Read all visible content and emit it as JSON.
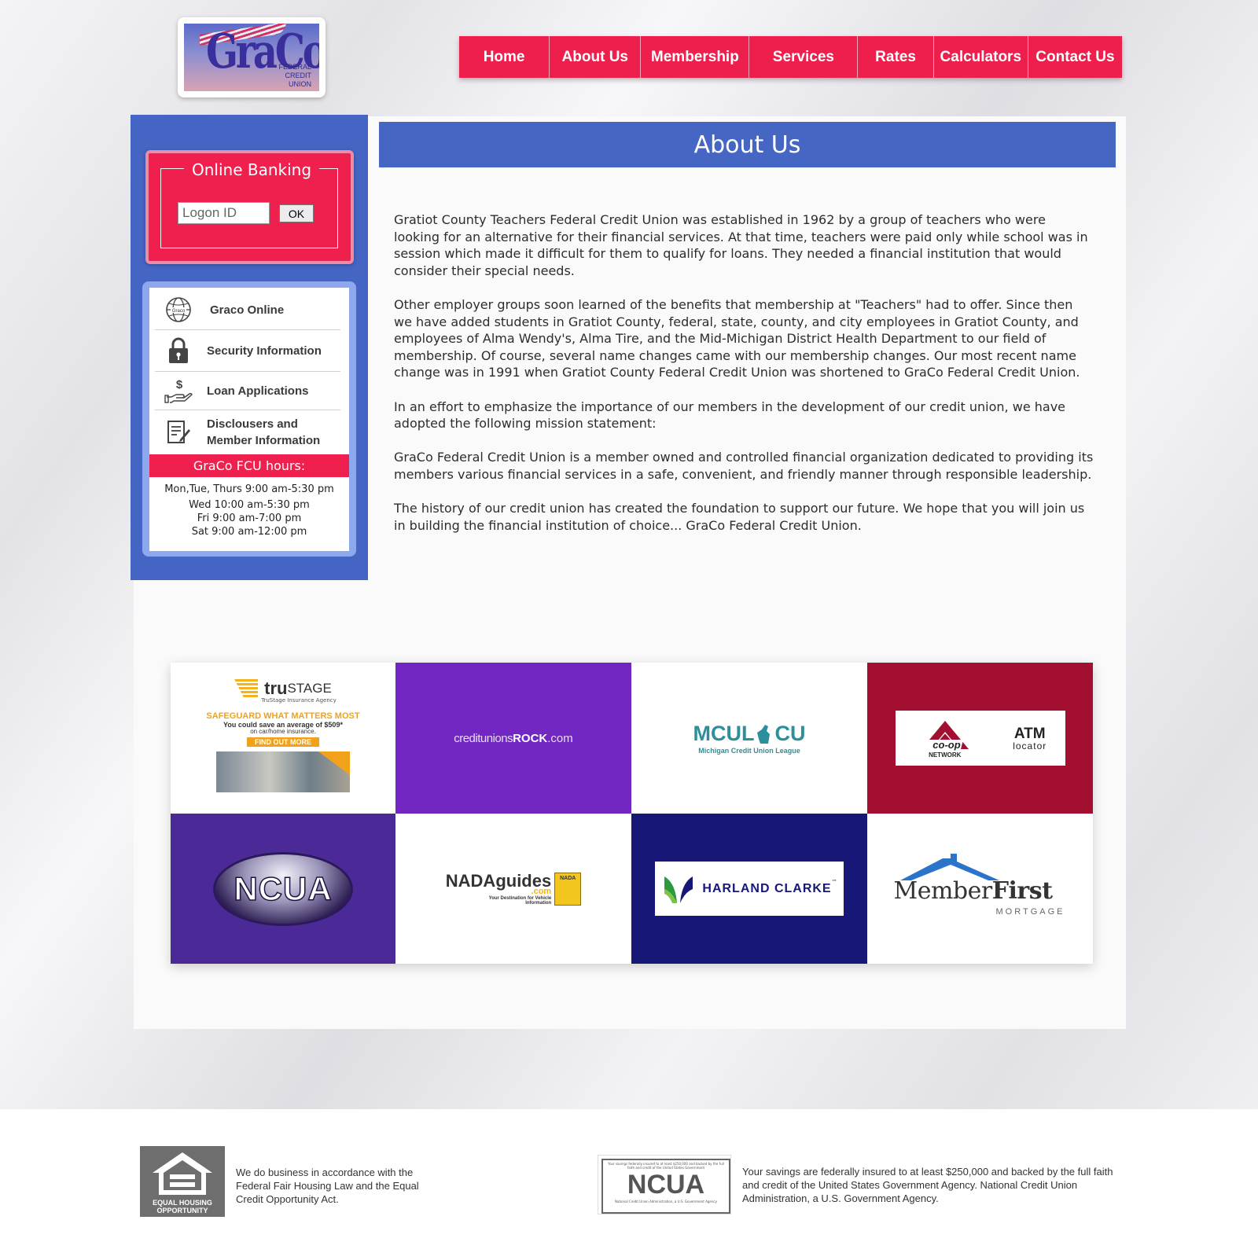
{
  "logo": {
    "main": "GraCo",
    "sub_lines": [
      "FEDERAL",
      "CREDIT",
      "UNION"
    ]
  },
  "nav": {
    "items": [
      "Home",
      "About Us",
      "Membership",
      "Services",
      "Rates",
      "Calculators",
      "Contact Us"
    ]
  },
  "online_banking": {
    "title": "Online Banking",
    "logon_placeholder": "Logon ID",
    "ok_label": "OK"
  },
  "sidebar": {
    "items": [
      {
        "label": "Graco Online",
        "icon": "globe-icon",
        "icon_text": "Graco"
      },
      {
        "label": "Security Information",
        "icon": "lock-icon"
      },
      {
        "label": "Loan Applications",
        "icon": "hand-dollar-icon"
      },
      {
        "label": "Disclousers and Member Information",
        "icon": "document-icon"
      }
    ],
    "hours_title": "GraCo FCU hours:",
    "hours": [
      "Mon,Tue, Thurs 9:00 am-5:30 pm",
      "Wed 10:00 am-5:30 pm",
      "Fri 9:00 am-7:00 pm",
      "Sat 9:00 am-12:00 pm"
    ]
  },
  "page_title": "About Us",
  "paragraphs": [
    "Gratiot County Teachers Federal Credit Union was established in 1962 by a group of teachers who were looking for an alternative for their financial services. At that time, teachers were paid only while school was in session which made it difficult for them to qualify for loans. They needed a financial institution that would consider their special needs.",
    "Other employer groups soon learned of the benefits that membership at \"Teachers\" had to offer. Since then we have added students in Gratiot County, federal, state, county, and city employees in Gratiot County, and employees of Alma Wendy's, Alma Tire, and the Mid-Michigan District Health Department to our field of membership. Of course, several name changes came with our membership changes. Our most recent name change was in 1991 when Gratiot County Federal Credit Union was shortened to GraCo Federal Credit Union.",
    "In an effort to emphasize the importance of our members in the development of our credit union, we have adopted the following mission statement:",
    "GraCo Federal Credit Union is a member owned and controlled financial organization dedicated to providing its members various financial services in a safe, convenient, and friendly manner through responsible leadership.",
    "The history of our credit union has created the foundation to support our future. We hope that you will join us in building the financial institution of choice... GraCo Federal Credit Union."
  ],
  "partners": {
    "trustage": {
      "brand_tru": "tru",
      "brand_stage": "STAGE",
      "agency": "TruStage Insurance Agency",
      "headline": "SAFEGUARD WHAT MATTERS MOST",
      "subline": "You could save an average of $509*",
      "subline2": "on car/home insurance.",
      "cta": "FIND OUT MORE"
    },
    "cur": {
      "pre": "creditunions",
      "bold": "ROCK",
      "post": ".com"
    },
    "mcul": {
      "left": "MCUL",
      "right": "CU",
      "sub": "Michigan Credit Union League"
    },
    "coop": {
      "name": "co-op",
      "network": "NETWORK",
      "atm": "ATM",
      "locator": "locator"
    },
    "ncua": {
      "text": "NCUA"
    },
    "nada": {
      "main": "NADAguides",
      "dotcom": ".com",
      "tagline": "Your Destination for Vehicle Information",
      "badge": "NADA"
    },
    "harland": {
      "text": "HARLAND CLARKE",
      "tm": "™"
    },
    "memberfirst": {
      "member": "Member",
      "first": "First",
      "sub": "MORTGAGE"
    }
  },
  "footer": {
    "ehl_label": "EQUAL HOUSING OPPORTUNITY",
    "ehl_text": "We do business in accordance with the Federal Fair Housing Law and the Equal Credit Opportunity Act.",
    "ncua_text": "Your savings are federally insured to at least $250,000 and backed by the full faith and credit of the United States Government Agency. National Credit Union Administration, a U.S. Government Agency.",
    "ncua_logo": "NCUA",
    "ncua_small_top": "Your savings federally insured to at least $250,000 and backed by the full faith and credit of the United States Government",
    "ncua_small_bottom": "National Credit Union Administration, a U.S. Government Agency"
  },
  "colors": {
    "accent_red": "#ef1f4e",
    "accent_blue": "#4567c3"
  }
}
